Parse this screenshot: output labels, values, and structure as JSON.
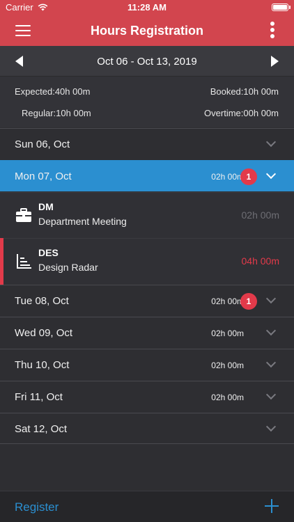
{
  "status": {
    "carrier": "Carrier",
    "time": "11:28 AM"
  },
  "header": {
    "title": "Hours Registration"
  },
  "week": {
    "range": "Oct 06 - Oct 13, 2019"
  },
  "summary": {
    "expected_k": "Expected",
    "expected_v": "40h 00m",
    "booked_k": "Booked",
    "booked_v": "10h 00m",
    "regular_k": "Regular",
    "regular_v": "10h 00m",
    "overtime_k": "Overtime",
    "overtime_v": "00h 00m"
  },
  "days": [
    {
      "date": "Sun 06, Oct",
      "hours": "",
      "badge": ""
    },
    {
      "date": "Mon 07, Oct",
      "hours": "02h 00m",
      "badge": "1"
    },
    {
      "date": "Tue 08, Oct",
      "hours": "02h 00m",
      "badge": "1"
    },
    {
      "date": "Wed 09, Oct",
      "hours": "02h 00m",
      "badge": ""
    },
    {
      "date": "Thu 10, Oct",
      "hours": "02h 00m",
      "badge": ""
    },
    {
      "date": "Fri 11, Oct",
      "hours": "02h 00m",
      "badge": ""
    },
    {
      "date": "Sat 12, Oct",
      "hours": "",
      "badge": ""
    }
  ],
  "entries": [
    {
      "code": "DM",
      "name": "Department Meeting",
      "hours": "02h 00m",
      "icon": "briefcase-icon"
    },
    {
      "code": "DES",
      "name": "Design Radar",
      "hours": "04h 00m",
      "icon": "chart-icon"
    }
  ],
  "bottom": {
    "register_label": "Register"
  },
  "colors": {
    "header": "#d2454e",
    "accent": "#2b8fd0",
    "alert": "#e23a4a",
    "background": "#2e2e32"
  }
}
